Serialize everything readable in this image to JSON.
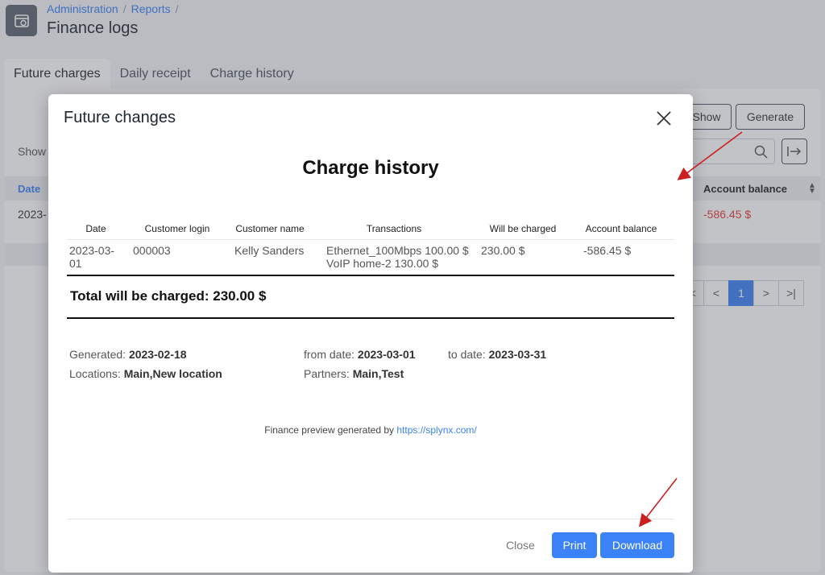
{
  "breadcrumb": {
    "items": [
      "Administration",
      "Reports"
    ],
    "separator": "/"
  },
  "page": {
    "title": "Finance logs"
  },
  "tabs": [
    {
      "label": "Future charges",
      "active": true
    },
    {
      "label": "Daily receipt",
      "active": false
    },
    {
      "label": "Charge history",
      "active": false
    }
  ],
  "toolbar": {
    "show_label": "Show",
    "generate_label": "Generate"
  },
  "list": {
    "show_entries_label": "Show"
  },
  "bg_table": {
    "headers": {
      "date": "Date",
      "account_balance": "Account balance"
    },
    "row": {
      "date": "2023-",
      "balance": "-586.45 $"
    }
  },
  "pagination": {
    "current_page": "1"
  },
  "modal": {
    "title": "Future changes",
    "report_title": "Charge history",
    "table": {
      "headers": [
        "Date",
        "Customer login",
        "Customer name",
        "Transactions",
        "Will be charged",
        "Account balance"
      ],
      "rows": [
        {
          "date": "2023-03-01",
          "login": "000003",
          "name": "Kelly Sanders",
          "transaction_1": "Ethernet_100Mbps 100.00 $",
          "transaction_2": "VoIP home-2 130.00 $",
          "will_be_charged": "230.00 $",
          "balance": "-586.45 $"
        }
      ]
    },
    "total": "Total will be charged: 230.00 $",
    "meta": {
      "generated_label": "Generated:",
      "generated_value": "2023-02-18",
      "from_label": "from date:",
      "from_value": "2023-03-01",
      "to_label": "to date:",
      "to_value": "2023-03-31",
      "locations_label": "Locations:",
      "locations_value": "Main,New location",
      "partners_label": "Partners:",
      "partners_value": "Main,Test"
    },
    "footer_note": {
      "text": "Finance preview generated by",
      "link": "https://splynx.com/"
    },
    "buttons": {
      "close": "Close",
      "print": "Print",
      "download": "Download"
    }
  },
  "colors": {
    "accent": "#3b82f6",
    "negative": "#e53935",
    "annotation_arrow": "#cc1f1f"
  }
}
